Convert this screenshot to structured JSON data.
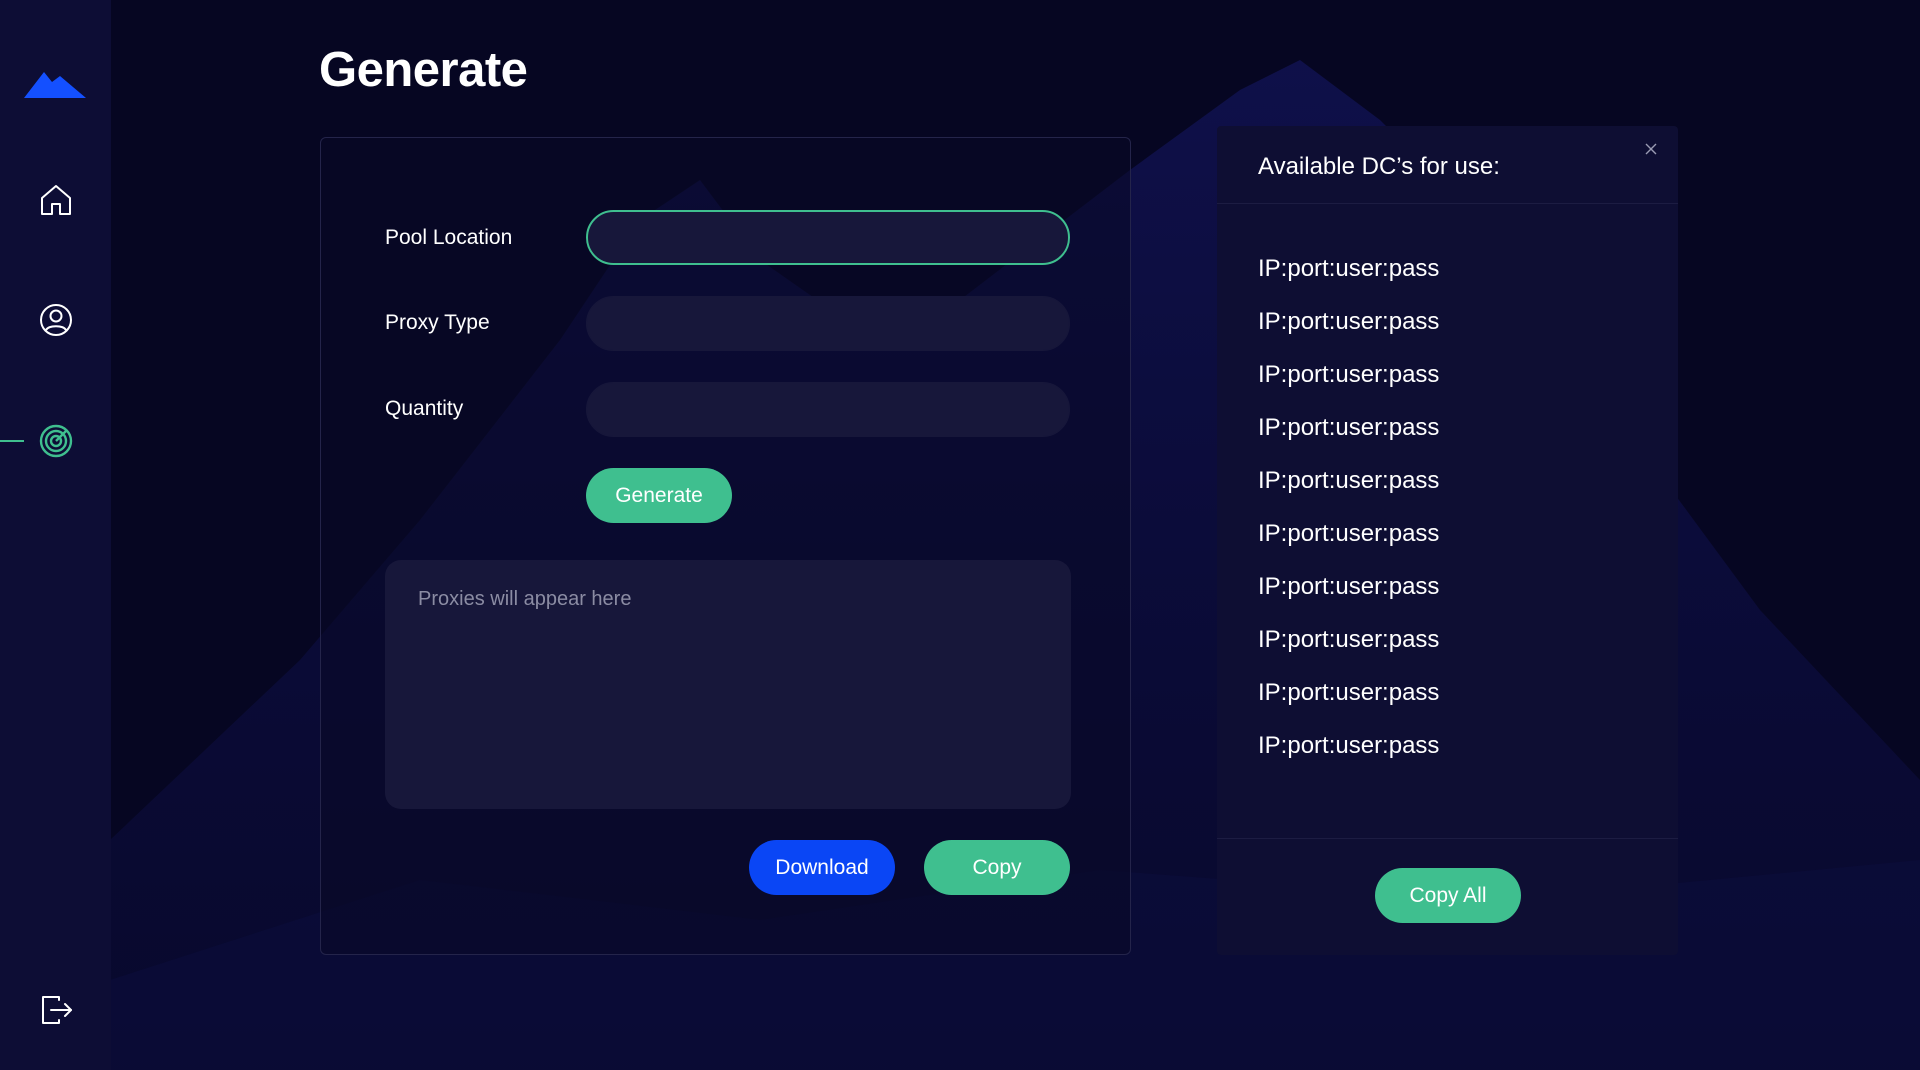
{
  "app": {
    "title": "Generate",
    "colors": {
      "background": "#060622",
      "sidebar": "#0d0d35",
      "panel": "#0e0e33",
      "input": "#17173a",
      "accent_green": "#3fbf8f",
      "accent_blue": "#0a46f5",
      "logo_blue": "#1450ff"
    }
  },
  "sidebar": {
    "items": [
      {
        "name": "home",
        "icon": "home-icon"
      },
      {
        "name": "account",
        "icon": "user-circle-icon"
      },
      {
        "name": "generate",
        "icon": "target-icon",
        "active": true
      },
      {
        "name": "logout",
        "icon": "logout-icon"
      }
    ]
  },
  "form": {
    "pool_location": {
      "label": "Pool Location",
      "value": "",
      "placeholder": ""
    },
    "proxy_type": {
      "label": "Proxy Type",
      "value": "",
      "placeholder": ""
    },
    "quantity": {
      "label": "Quantity",
      "value": "",
      "placeholder": ""
    },
    "generate_label": "Generate",
    "output_placeholder": "Proxies will appear here",
    "download_label": "Download",
    "copy_label": "Copy"
  },
  "dc_panel": {
    "title": "Available DC’s for use:",
    "close_icon": "close-icon",
    "items": [
      "IP:port:user:pass",
      "IP:port:user:pass",
      "IP:port:user:pass",
      "IP:port:user:pass",
      "IP:port:user:pass",
      "IP:port:user:pass",
      "IP:port:user:pass",
      "IP:port:user:pass",
      "IP:port:user:pass",
      "IP:port:user:pass"
    ],
    "copy_all_label": "Copy All"
  }
}
